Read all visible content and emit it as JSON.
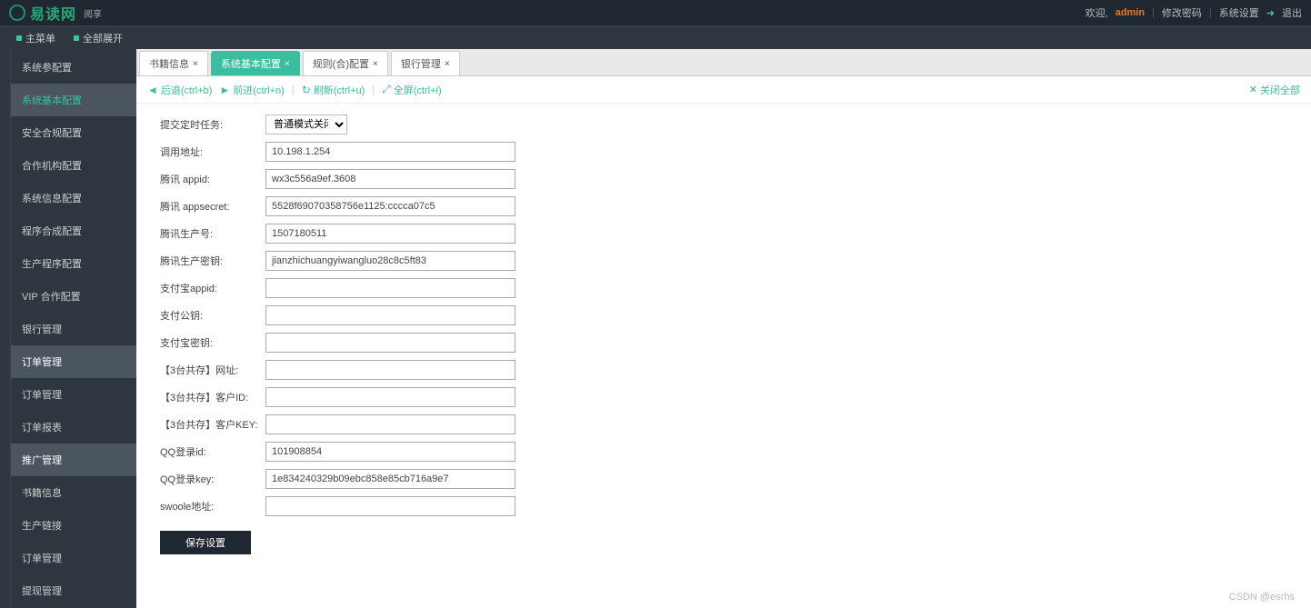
{
  "header": {
    "logo_text": "易读网",
    "logo_sub": "阅享",
    "welcome": "欢迎,",
    "username": "admin",
    "links": [
      "修改密码",
      "系统设置",
      "退出"
    ]
  },
  "menubar": [
    {
      "label": "主菜单"
    },
    {
      "label": "全部展开"
    }
  ],
  "sidebar": {
    "items": [
      {
        "label": "系统参配置"
      },
      {
        "label": "系统基本配置"
      },
      {
        "label": "安全合规配置"
      },
      {
        "label": "合作机构配置"
      },
      {
        "label": "系统信息配置"
      },
      {
        "label": "程序合成配置"
      },
      {
        "label": "生产程序配置"
      },
      {
        "label": "VIP 合作配置"
      },
      {
        "label": "银行管理"
      },
      {
        "label": "订单管理"
      },
      {
        "label": "订单管理"
      },
      {
        "label": "订单报表"
      },
      {
        "label": "推广管理"
      },
      {
        "label": "书籍信息"
      },
      {
        "label": "生产链接"
      },
      {
        "label": "订单管理"
      },
      {
        "label": "提现管理"
      }
    ],
    "active_index": 1,
    "hover_indices": [
      9,
      12
    ]
  },
  "tabs": {
    "items": [
      {
        "label": "书籍信息"
      },
      {
        "label": "系统基本配置"
      },
      {
        "label": "规则(合)配置"
      },
      {
        "label": "银行管理"
      }
    ],
    "active_index": 1
  },
  "toolbar": {
    "back": "后退(ctrl+b)",
    "forward": "前进(ctrl+n)",
    "refresh": "刷新(ctrl+u)",
    "fullscreen": "全屏(ctrl+i)",
    "close_all": "关闭全部"
  },
  "form": {
    "rows": [
      {
        "label": "提交定时任务:",
        "type": "select",
        "value": "普通模式关闭"
      },
      {
        "label": "调用地址:",
        "type": "input",
        "value": "10.198.1.254"
      },
      {
        "label": "腾讯 appid:",
        "type": "input",
        "value": "wx3c556a9ef.3608"
      },
      {
        "label": "腾讯 appsecret:",
        "type": "input",
        "value": "5528f69070358756e1125:cccca07c5"
      },
      {
        "label": "腾讯生产号:",
        "type": "input",
        "value": "1507180511"
      },
      {
        "label": "腾讯生产密钥:",
        "type": "input",
        "value": "jianzhichuangyiwangluo28c8c5ft83"
      },
      {
        "label": "支付宝appid:",
        "type": "input",
        "value": ""
      },
      {
        "label": "支付公钥:",
        "type": "input",
        "value": ""
      },
      {
        "label": "支付宝密钥:",
        "type": "input",
        "value": ""
      },
      {
        "label": "【3台共存】网址:",
        "type": "input",
        "value": ""
      },
      {
        "label": "【3台共存】客户ID:",
        "type": "input",
        "value": ""
      },
      {
        "label": "【3台共存】客户KEY:",
        "type": "input",
        "value": ""
      },
      {
        "label": "QQ登录id:",
        "type": "input",
        "value": "101908854"
      },
      {
        "label": "QQ登录key:",
        "type": "input",
        "value": "1e834240329b09ebc858e85cb716a9e7"
      },
      {
        "label": "swoole地址:",
        "type": "input",
        "value": ""
      }
    ],
    "save_label": "保存设置"
  },
  "watermark": "CSDN @esrhs"
}
